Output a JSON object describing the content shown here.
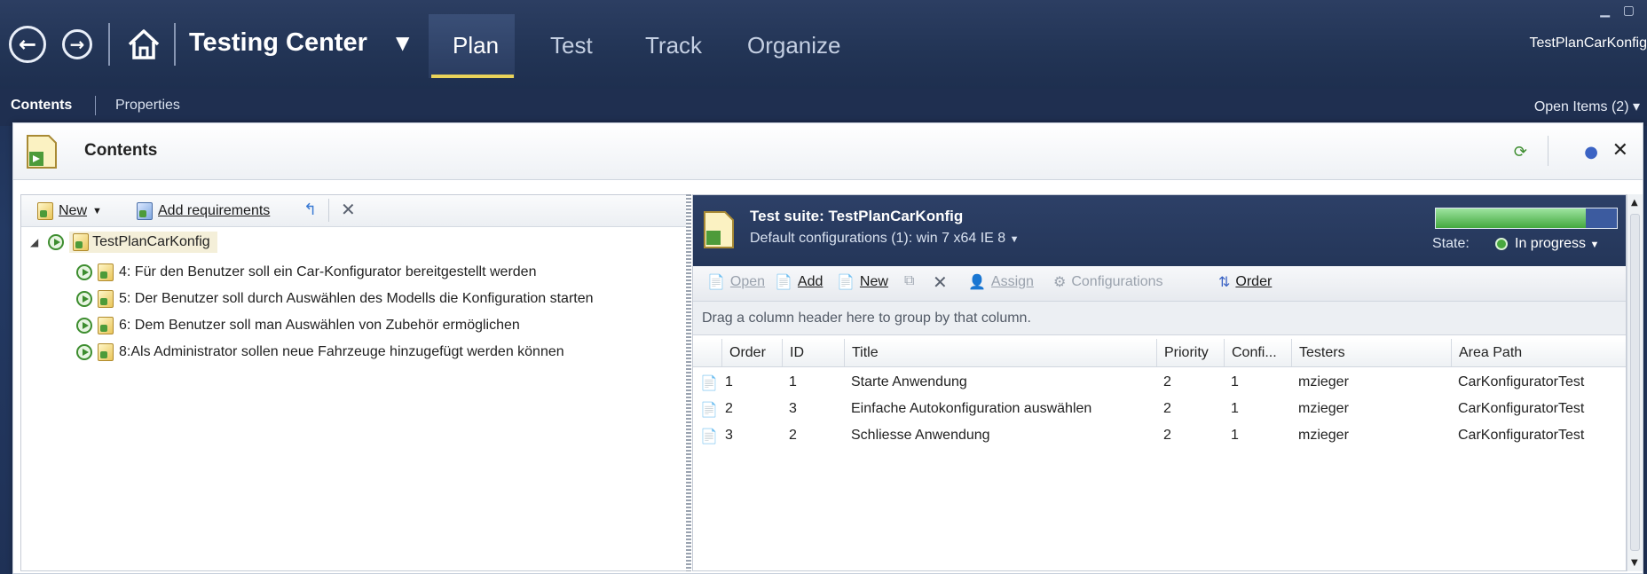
{
  "nav": {
    "back_glyph": "←",
    "forward_glyph": "→",
    "app_title": "Testing Center",
    "tabs": [
      "Plan",
      "Test",
      "Track",
      "Organize"
    ],
    "active_tab": "Plan",
    "user_label": "TestPlanCarKonfig"
  },
  "subnav": {
    "tabs": [
      "Contents",
      "Properties"
    ],
    "active": "Contents",
    "open_items": "Open Items (2)"
  },
  "panel": {
    "title": "Contents"
  },
  "tree": {
    "toolbar": {
      "new_label": "New",
      "add_requirements_label": "Add requirements"
    },
    "root": "TestPlanCarKonfig",
    "children": [
      "4: Für den Benutzer soll ein Car-Konfigurator bereitgestellt werden",
      "5: Der Benutzer soll durch Auswählen des Modells die Konfiguration starten",
      "6: Dem Benutzer soll man Auswählen von Zubehör ermöglichen",
      "8:Als Administrator sollen neue Fahrzeuge hinzugefügt werden können"
    ]
  },
  "suite": {
    "title": "Test suite:  TestPlanCarKonfig",
    "config": "Default configurations (1):  win 7 x64 IE 8",
    "state_label": "State:",
    "state_value": "In progress",
    "progress": 0.83,
    "toolbar": {
      "open": "Open",
      "add": "Add",
      "new": "New",
      "assign": "Assign",
      "configurations": "Configurations",
      "order": "Order"
    },
    "group_hint": "Drag a column header here to group by that column.",
    "columns": [
      "Order",
      "ID",
      "Title",
      "Priority",
      "Confi...",
      "Testers",
      "Area Path"
    ],
    "rows": [
      [
        "1",
        "1",
        "Starte Anwendung",
        "2",
        "1",
        "mzieger",
        "CarKonfiguratorTest"
      ],
      [
        "2",
        "3",
        "Einfache Autokonfiguration auswählen",
        "2",
        "1",
        "mzieger",
        "CarKonfiguratorTest"
      ],
      [
        "3",
        "2",
        "Schliesse Anwendung",
        "2",
        "1",
        "mzieger",
        "CarKonfiguratorTest"
      ]
    ]
  },
  "colors": {
    "topbar": "#223455",
    "accent_underline": "#e9d35a",
    "suite_header": "#2d4067",
    "progress_green": "#43a83e"
  }
}
